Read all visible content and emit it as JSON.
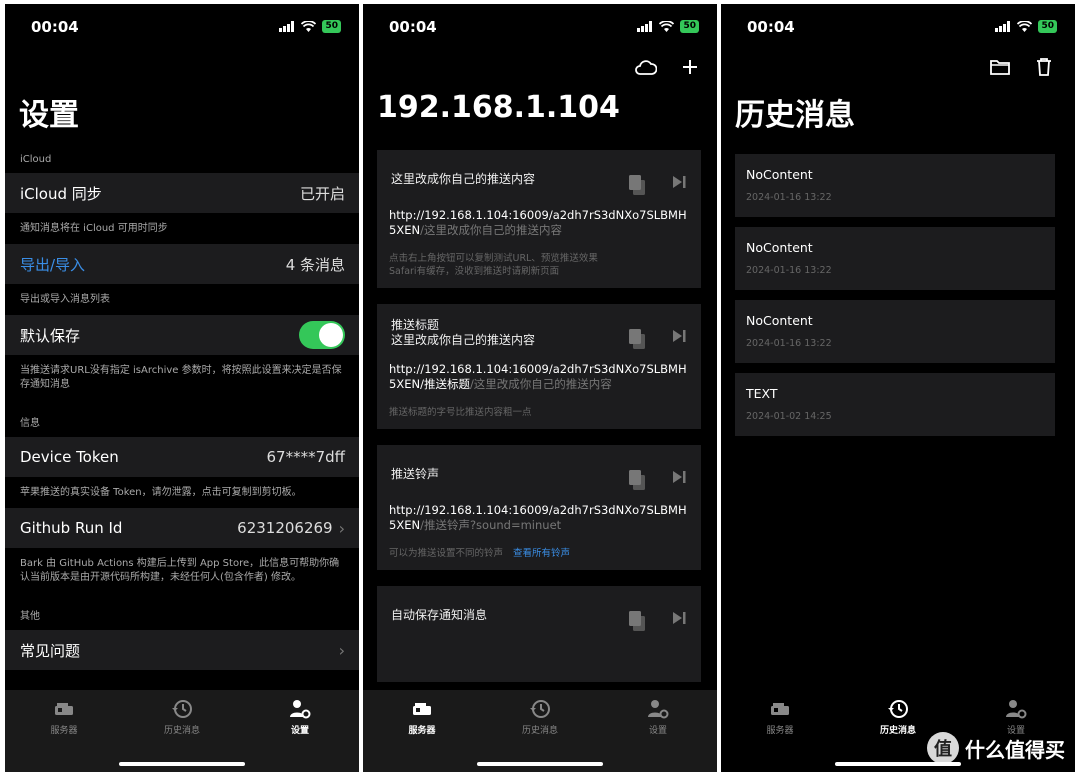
{
  "status": {
    "time": "00:04",
    "battery": "50"
  },
  "tabs": {
    "servers": "服务器",
    "history": "历史消息",
    "settings": "设置"
  },
  "settings_screen": {
    "title": "设置",
    "icloud_header": "iCloud",
    "icloud_sync_label": "iCloud 同步",
    "icloud_sync_value": "已开启",
    "icloud_footer": "通知消息将在 iCloud 可用时同步",
    "export_label": "导出/导入",
    "export_value": "4 条消息",
    "export_footer": "导出或导入消息列表",
    "default_save_label": "默认保存",
    "default_save_on": true,
    "default_save_footer": "当推送请求URL没有指定 isArchive 参数时，将按照此设置来决定是否保存通知消息",
    "info_header": "信息",
    "device_token_label": "Device Token",
    "device_token_value": "67****7dff",
    "device_token_footer": "苹果推送的真实设备 Token，请勿泄露，点击可复制到剪切板。",
    "github_label": "Github Run Id",
    "github_value": "6231206269",
    "github_footer": "Bark 由 GitHub Actions 构建后上传到 App Store，此信息可帮助你确认当前版本是由开源代码所构建，未经任何人(包含作者) 修改。",
    "other_header": "其他",
    "faq_label": "常见问题"
  },
  "server_screen": {
    "title": "192.168.1.104",
    "cards": [
      {
        "title_lines": [
          "这里改成你自己的推送内容"
        ],
        "url_main": "http://192.168.1.104:16009/a2dh7rS3dNXo7SLBMH5XEN",
        "url_tail": "/这里改成你自己的推送内容",
        "note_lines": [
          "点击右上角按钮可以复制测试URL、预览推送效果",
          "Safari有缓存，没收到推送时请刷新页面"
        ],
        "note_link": ""
      },
      {
        "title_lines": [
          "推送标题",
          "这里改成你自己的推送内容"
        ],
        "url_main": "http://192.168.1.104:16009/a2dh7rS3dNXo7SLBMH5XEN/推送标题",
        "url_tail": "/这里改成你自己的推送内容",
        "note_lines": [
          "推送标题的字号比推送内容粗一点"
        ],
        "note_link": ""
      },
      {
        "title_lines": [
          "推送铃声"
        ],
        "url_main": "http://192.168.1.104:16009/a2dh7rS3dNXo7SLBMH5XEN",
        "url_tail": "/推送铃声?sound=minuet",
        "note_lines": [
          "可以为推送设置不同的铃声"
        ],
        "note_link": "查看所有铃声"
      },
      {
        "title_lines": [
          "自动保存通知消息"
        ],
        "url_main": "",
        "url_tail": "",
        "note_lines": [],
        "note_link": ""
      }
    ]
  },
  "history_screen": {
    "title": "历史消息",
    "messages": [
      {
        "title": "NoContent",
        "time": "2024-01-16 13:22"
      },
      {
        "title": "NoContent",
        "time": "2024-01-16 13:22"
      },
      {
        "title": "NoContent",
        "time": "2024-01-16 13:22"
      },
      {
        "title": "TEXT",
        "time": "2024-01-02 14:25"
      }
    ]
  },
  "watermark": {
    "logo": "值",
    "text": "什么值得买"
  },
  "colors": {
    "accent": "#3a8ee6",
    "toggle_on": "#34c759",
    "cell_bg": "#1c1c1e"
  }
}
